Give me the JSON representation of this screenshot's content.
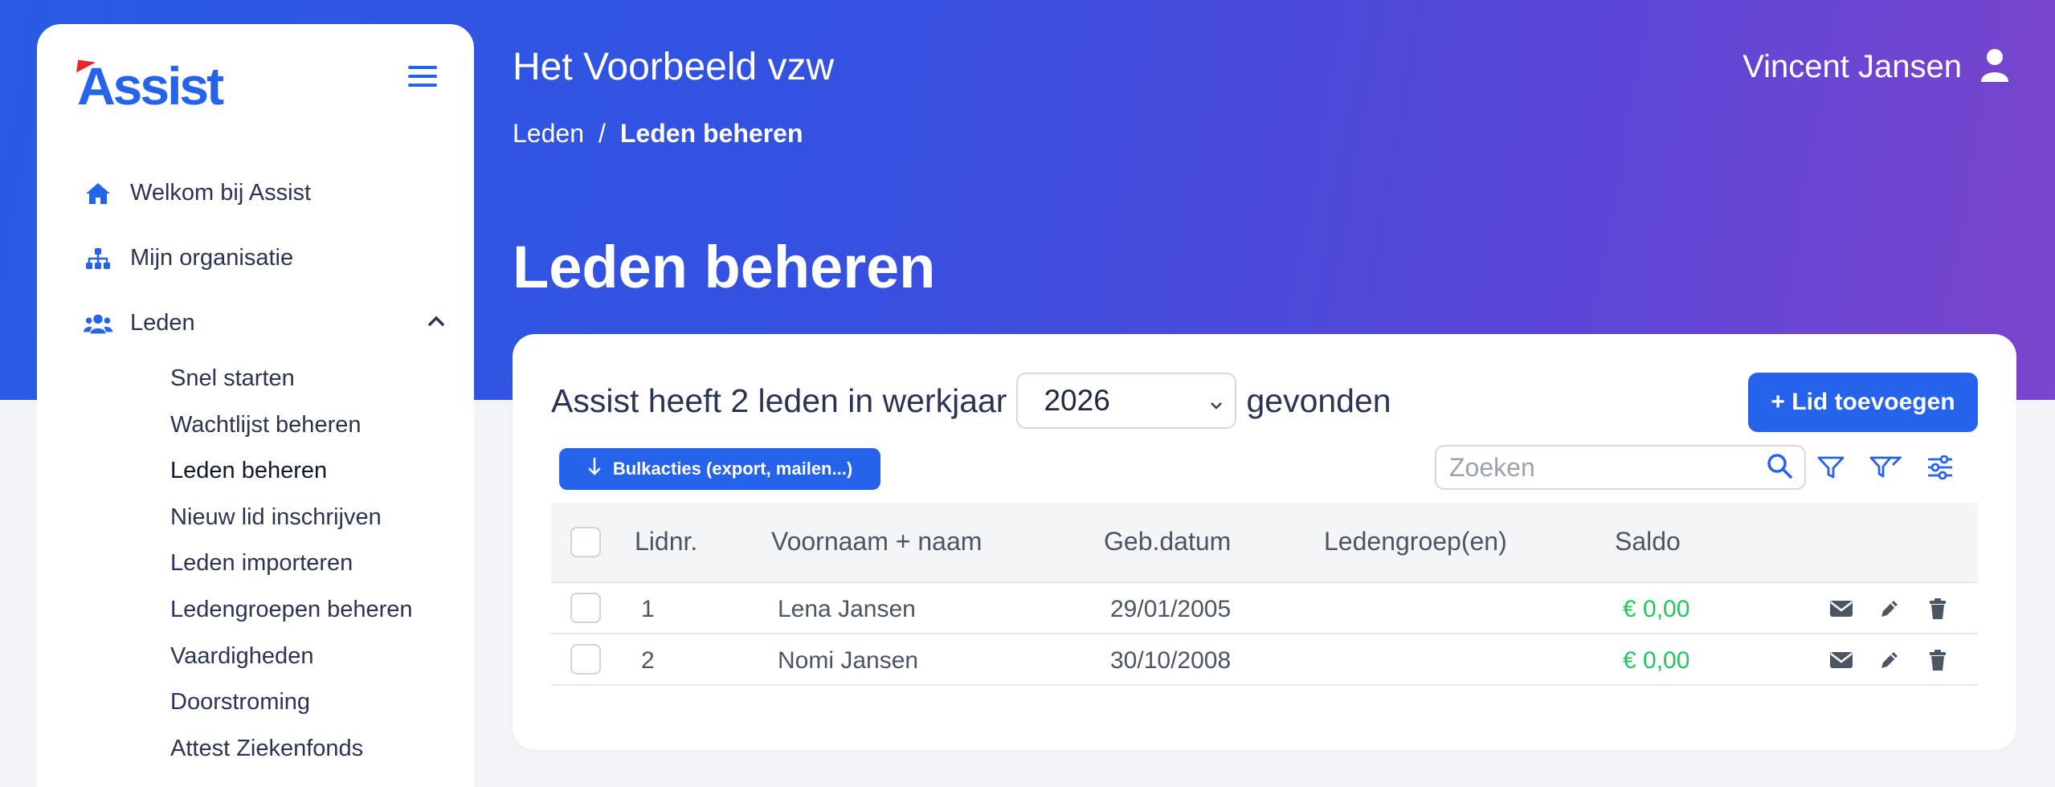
{
  "app": {
    "logo_text": "Assist"
  },
  "sidebar": {
    "items": [
      {
        "label": "Welkom bij Assist",
        "icon": "home-icon"
      },
      {
        "label": "Mijn organisatie",
        "icon": "sitemap-icon"
      },
      {
        "label": "Leden",
        "icon": "users-icon",
        "expanded": true
      }
    ],
    "subitems": [
      "Snel starten",
      "Wachtlijst beheren",
      "Leden beheren",
      "Nieuw lid inschrijven",
      "Leden importeren",
      "Ledengroepen beheren",
      "Vaardigheden",
      "Doorstroming",
      "Attest Ziekenfonds"
    ]
  },
  "header": {
    "org": "Het Voorbeeld vzw",
    "breadcrumb": [
      "Leden",
      "/",
      "Leden beheren"
    ],
    "user": "Vincent Jansen",
    "page_title": "Leden beheren"
  },
  "card": {
    "summary_prefix": "Assist heeft 2 leden in werkjaar",
    "year": "2026",
    "summary_suffix": "gevonden",
    "add_button": "+ Lid toevoegen",
    "bulk_button": "Bulkacties (export, mailen...)",
    "search_placeholder": "Zoeken"
  },
  "table": {
    "columns": [
      "Lidnr.",
      "Voornaam + naam",
      "Geb.datum",
      "Ledengroep(en)",
      "Saldo"
    ],
    "rows": [
      {
        "nr": "1",
        "name": "Lena Jansen",
        "dob": "29/01/2005",
        "groups": "",
        "saldo": "€ 0,00"
      },
      {
        "nr": "2",
        "name": "Nomi Jansen",
        "dob": "30/10/2008",
        "groups": "",
        "saldo": "€ 0,00"
      }
    ]
  },
  "colors": {
    "primary": "#2563eb",
    "positive": "#22c55e",
    "brand_red": "#e8242e"
  }
}
